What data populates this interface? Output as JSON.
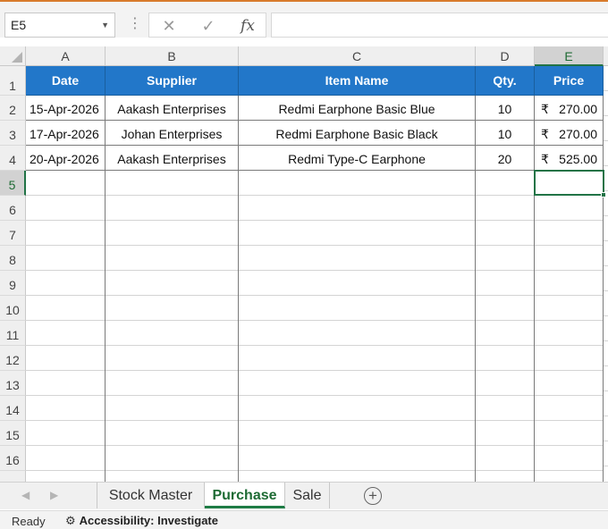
{
  "formula_bar": {
    "name_box": "E5",
    "dropdown_icon": "chevron-down-icon",
    "cancel_icon": "✕",
    "enter_icon": "✓",
    "fx_label": "fx",
    "formula": ""
  },
  "columns": [
    "A",
    "B",
    "C",
    "D",
    "E"
  ],
  "rows": [
    "1",
    "2",
    "3",
    "4",
    "5",
    "6",
    "7",
    "8",
    "9",
    "10",
    "11",
    "12",
    "13",
    "14",
    "15",
    "16"
  ],
  "table": {
    "headers": [
      "Date",
      "Supplier",
      "Item Name",
      "Qty.",
      "Price"
    ],
    "records": [
      {
        "date": "15-Apr-2026",
        "supplier": "Aakash Enterprises",
        "item": "Redmi Earphone Basic Blue",
        "qty": "10",
        "currency": "₹",
        "price": "270.00"
      },
      {
        "date": "17-Apr-2026",
        "supplier": "Johan Enterprises",
        "item": "Redmi Earphone Basic Black",
        "qty": "10",
        "currency": "₹",
        "price": "270.00"
      },
      {
        "date": "20-Apr-2026",
        "supplier": "Aakash Enterprises",
        "item": "Redmi Type-C Earphone",
        "qty": "20",
        "currency": "₹",
        "price": "525.00"
      }
    ]
  },
  "selected_cell": "E5",
  "sheet_tabs": [
    {
      "label": "Stock Master",
      "active": false
    },
    {
      "label": "Purchase",
      "active": true
    },
    {
      "label": "Sale",
      "active": false
    }
  ],
  "status": {
    "ready": "Ready",
    "accessibility": "Accessibility: Investigate"
  },
  "colors": {
    "header_fill": "#2277c9",
    "selection": "#217346"
  }
}
